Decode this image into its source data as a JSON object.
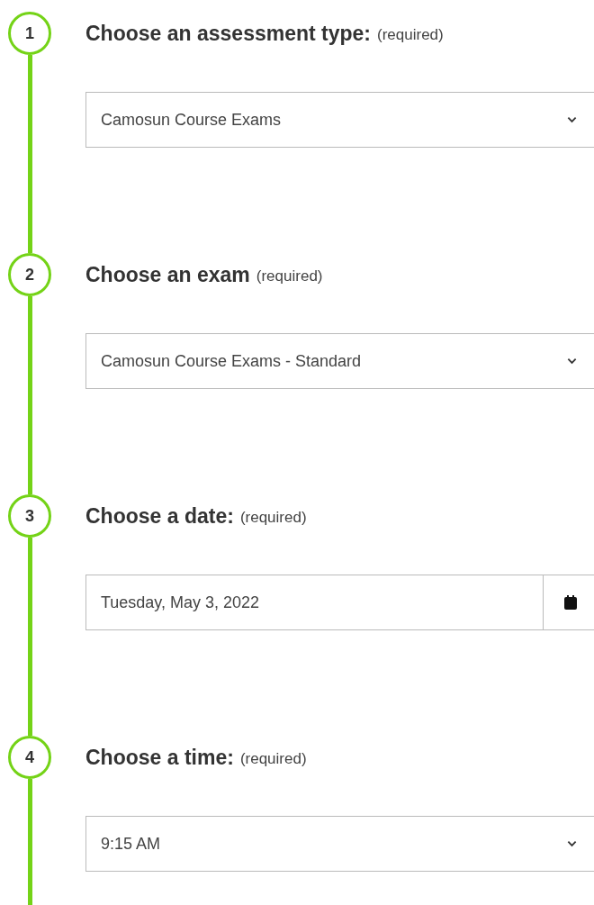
{
  "steps": [
    {
      "number": "1",
      "title": "Choose an assessment type:",
      "note": "(required)",
      "field": {
        "kind": "select",
        "value": "Camosun Course Exams"
      }
    },
    {
      "number": "2",
      "title": "Choose an exam",
      "note": "(required)",
      "field": {
        "kind": "select",
        "value": "Camosun Course Exams - Standard"
      }
    },
    {
      "number": "3",
      "title": "Choose a date:",
      "note": "(required)",
      "field": {
        "kind": "date",
        "value": "Tuesday, May 3, 2022"
      }
    },
    {
      "number": "4",
      "title": "Choose a time:",
      "note": "(required)",
      "field": {
        "kind": "select",
        "value": "9:15 AM"
      }
    }
  ]
}
